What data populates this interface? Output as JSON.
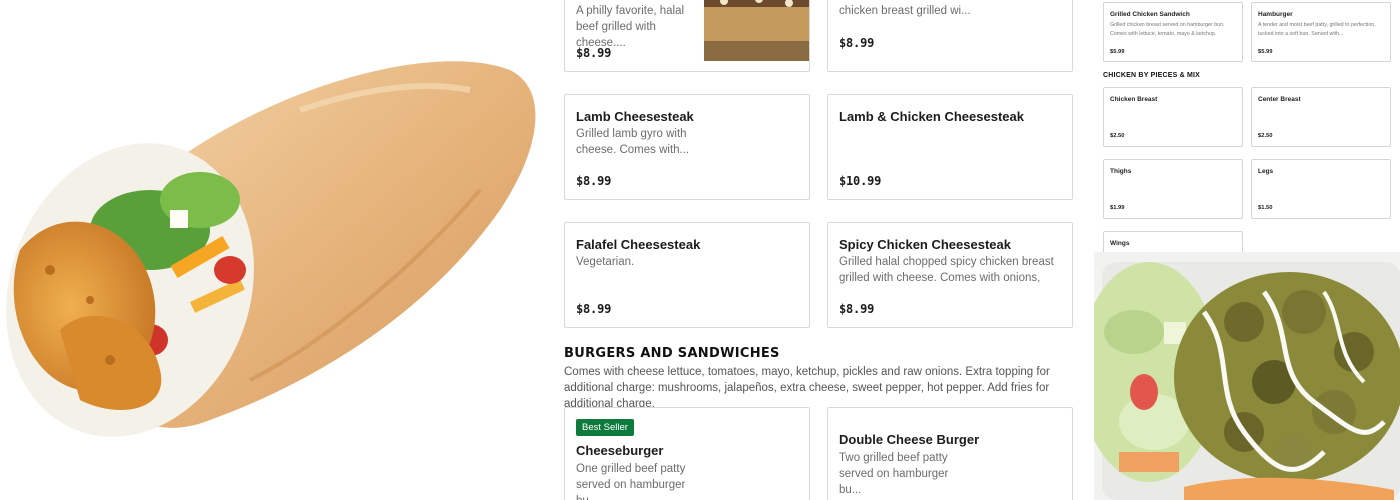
{
  "cheesesteaks": {
    "items": [
      {
        "title": "",
        "desc": "A philly favorite, halal beef grilled with cheese....",
        "price": "$8.99"
      },
      {
        "title": "",
        "desc": "chicken breast grilled wi...",
        "price": "$8.99"
      },
      {
        "title": "Lamb Cheesesteak",
        "desc": "Grilled lamb gyro with cheese. Comes with...",
        "price": "$8.99"
      },
      {
        "title": "Lamb & Chicken Cheesesteak",
        "desc": "",
        "price": "$10.99"
      },
      {
        "title": "Falafel Cheesesteak",
        "desc": "Vegetarian.",
        "price": "$8.99"
      },
      {
        "title": "Spicy Chicken Cheesesteak",
        "desc": "Grilled halal chopped spicy chicken breast grilled with cheese. Comes with onions, green pepper,...",
        "price": "$8.99"
      }
    ]
  },
  "burgers": {
    "heading": "BURGERS AND SANDWICHES",
    "description": "Comes with cheese lettuce, tomatoes, mayo, ketchup, pickles and raw onions. Extra topping for additional charge: mushrooms, jalapeños, extra cheese, sweet pepper, hot pepper. Add fries for additional charge.",
    "items": [
      {
        "badge": "Best Seller",
        "title": "Cheeseburger",
        "desc": "One grilled beef patty served on hamburger bu..."
      },
      {
        "title": "Double Cheese Burger",
        "desc": "Two grilled beef patty served on hamburger bu..."
      }
    ]
  },
  "mini_menu": {
    "top_items": [
      {
        "title": "Grilled Chicken Sandwich",
        "desc": "Grilled chicken breast served on hamburger bun. Comes with lettuce, tomato, mayo & ketchup.",
        "price": "$5.99"
      },
      {
        "title": "Hamburger",
        "desc": "A tender and moist beef patty, grilled to perfection, tucked into a soft bun. Served with...",
        "price": "$5.99"
      }
    ],
    "section_heading": "CHICKEN BY PIECES & MIX",
    "pieces": [
      {
        "title": "Chicken Breast",
        "price": "$2.50"
      },
      {
        "title": "Center Breast",
        "price": "$2.50"
      },
      {
        "title": "Thighs",
        "price": "$1.99"
      },
      {
        "title": "Legs",
        "price": "$1.50"
      },
      {
        "title": "Wings"
      }
    ]
  },
  "images": {
    "hero": "chicken-wrap-photo",
    "food": "falafel-platter-photo",
    "thumb": "cheesesteak-thumbnail"
  }
}
